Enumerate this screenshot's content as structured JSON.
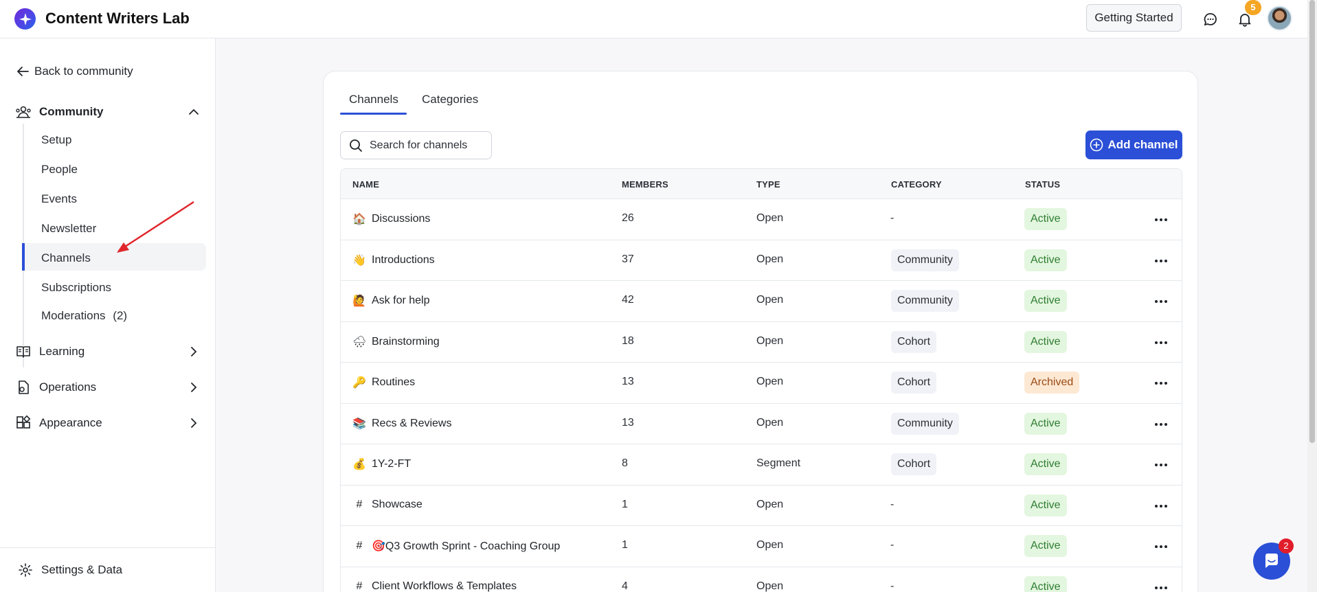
{
  "app": {
    "title": "Content Writers Lab"
  },
  "header": {
    "getting_started_label": "Getting Started",
    "notification_count": "5",
    "accent": "#2b4fd6"
  },
  "sidebar": {
    "back_label": "Back to community",
    "community": {
      "label": "Community",
      "items": [
        {
          "label": "Setup"
        },
        {
          "label": "People"
        },
        {
          "label": "Events"
        },
        {
          "label": "Newsletter"
        },
        {
          "label": "Channels",
          "active": true
        },
        {
          "label": "Subscriptions"
        },
        {
          "label": "Moderations",
          "count": "(2)"
        }
      ]
    },
    "learning_label": "Learning",
    "operations_label": "Operations",
    "appearance_label": "Appearance",
    "settings_label": "Settings & Data"
  },
  "main": {
    "tabs": [
      {
        "label": "Channels",
        "selected": true
      },
      {
        "label": "Categories"
      }
    ],
    "search": {
      "placeholder": "Search for channels"
    },
    "add_button_label": "Add channel",
    "columns": {
      "name": "NAME",
      "members": "MEMBERS",
      "type": "TYPE",
      "category": "CATEGORY",
      "status": "STATUS"
    },
    "rows": [
      {
        "icon": "🏠",
        "name": "Discussions",
        "members": "26",
        "type": "Open",
        "category": "-",
        "status": "Active"
      },
      {
        "icon": "👋",
        "name": "Introductions",
        "members": "37",
        "type": "Open",
        "category": "Community",
        "status": "Active"
      },
      {
        "icon": "🙋",
        "name": "Ask for help",
        "members": "42",
        "type": "Open",
        "category": "Community",
        "status": "Active"
      },
      {
        "icon": "🌧",
        "name": "Brainstorming",
        "members": "18",
        "type": "Open",
        "category": "Cohort",
        "status": "Active"
      },
      {
        "icon": "🔑",
        "name": "Routines",
        "members": "13",
        "type": "Open",
        "category": "Cohort",
        "status": "Archived"
      },
      {
        "icon": "📚",
        "name": "Recs & Reviews",
        "members": "13",
        "type": "Open",
        "category": "Community",
        "status": "Active"
      },
      {
        "icon": "💰",
        "name": "1Y-2-FT",
        "members": "8",
        "type": "Segment",
        "category": "Cohort",
        "status": "Active"
      },
      {
        "icon": "#",
        "name": "Showcase",
        "members": "1",
        "type": "Open",
        "category": "-",
        "status": "Active"
      },
      {
        "icon": "#",
        "name": "🎯Q3 Growth Sprint - Coaching Group",
        "members": "1",
        "type": "Open",
        "category": "-",
        "status": "Active"
      },
      {
        "icon": "#",
        "name": "Client Workflows & Templates",
        "members": "4",
        "type": "Open",
        "category": "-",
        "status": "Active"
      }
    ]
  },
  "chat": {
    "badge_count": "2"
  }
}
